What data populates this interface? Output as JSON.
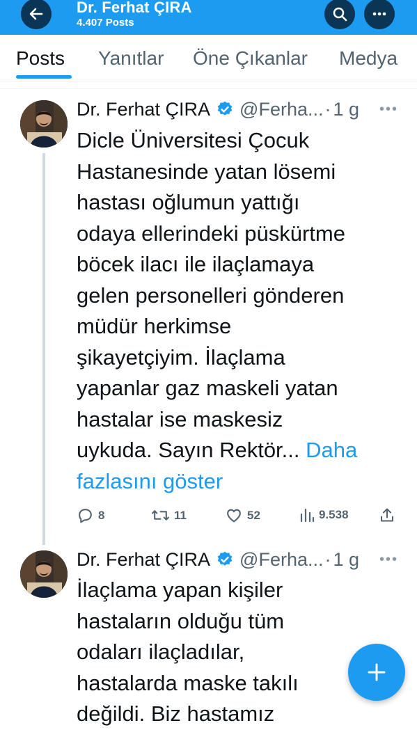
{
  "header": {
    "title": "Dr. Ferhat ÇIRA",
    "post_count": "4.407 Posts",
    "back_icon": "arrow-left-icon",
    "search_icon": "search-icon",
    "more_icon": "more-horizontal-icon",
    "bar_color": "#1d9bf0",
    "button_color": "#0b3554"
  },
  "tabs": [
    {
      "label": "Posts",
      "active": true
    },
    {
      "label": "Yanıtlar",
      "active": false
    },
    {
      "label": "Öne Çıkanlar",
      "active": false
    },
    {
      "label": "Medya",
      "active": false
    }
  ],
  "posts": [
    {
      "author": "Dr. Ferhat ÇIRA",
      "handle": "@Ferha...",
      "separator": "·",
      "age": "1 g",
      "lines": [
        "Dicle Üniversitesi Çocuk",
        "Hastanesinde yatan lösemi",
        "hastası oğlumun yattığı",
        "odaya ellerindeki püskürtme",
        "böcek ilacı ile ilaçlamaya",
        "gelen personelleri gönderen",
        "müdür herkimse",
        "şikayetçiyim. İlaçlama",
        "yapanlar gaz maskeli yatan",
        "hastalar ise maskesiz",
        "uykuda. Sayın Rektör..."
      ],
      "show_more_part1": "Daha",
      "show_more_part2": "fazlasını göster",
      "replies": "8",
      "reposts": "11",
      "likes": "52",
      "views": "9.538"
    },
    {
      "author": "Dr. Ferhat ÇIRA",
      "handle": "@Ferha...",
      "separator": "·",
      "age": "1 g",
      "lines": [
        "İlaçlama yapan kişiler",
        "hastaların olduğu tüm",
        "odaları ilaçladılar,",
        "hastalarda maske takılı",
        "değildi. Biz hastamız"
      ]
    }
  ],
  "fab": {
    "icon": "plus-icon",
    "label": "+"
  }
}
